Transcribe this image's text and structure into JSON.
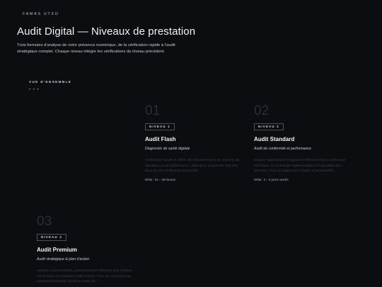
{
  "brand": "FAMAS UTXO",
  "title": "Audit Digital — Niveaux de prestation",
  "intro": "Trois formules d'analyse de votre présence numérique, de la vérification rapide à l'audit stratégique complet. Chaque niveau intègre les vérifications du niveau précédent.",
  "overview": {
    "label": "VUE D'ENSEMBLE",
    "dots": "• • •"
  },
  "tiers": [
    {
      "number": "01",
      "badge": "NIVEAU 1",
      "name": "Audit Flash",
      "subtitle": "Diagnostic de santé digitale",
      "description": "Vérification rapide et ciblée des fondamentaux de sécurité, de réputation et de performance. Idéal pour un premier état des lieux ou une vérification ponctuelle.",
      "delay": "Délai : 24 – 48 heures"
    },
    {
      "number": "02",
      "badge": "NIVEAU 2",
      "name": "Audit Standard",
      "subtitle": "Audit de conformité et performance",
      "description": "Analyse approfondie intégrant le référencement, la structure technique, la conformité réglementaire et l'exposition des données. Pour un diagnostic complet et actionnable.",
      "delay": "Délai : 3 – 5 jours ouvrés"
    },
    {
      "number": "03",
      "badge": "NIVEAU 3",
      "name": "Audit Premium",
      "subtitle": "Audit stratégique & plan d'action",
      "description": "Analyse concurrentielle, positionnement éditorial, plan d'action sur 90 jours et restitution orale incluse. Pour les structures qui veulent transformer l'audit en levier de",
      "delay": ""
    }
  ]
}
